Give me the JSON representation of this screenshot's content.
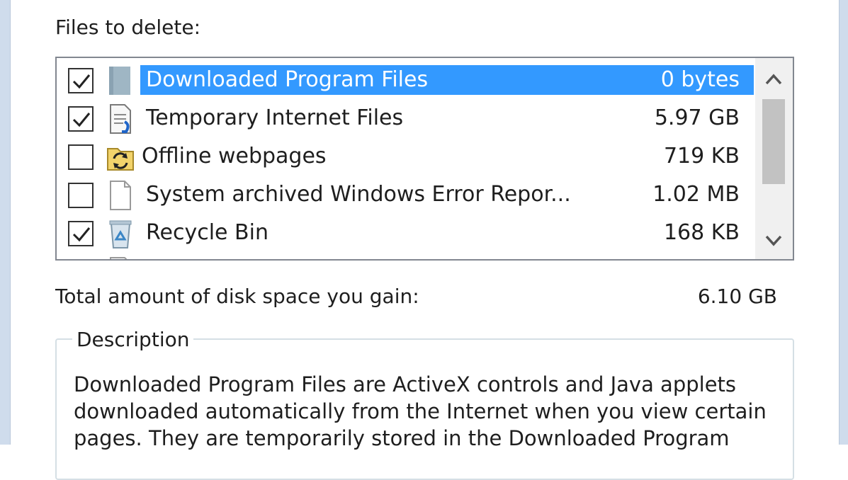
{
  "files_label": "Files to delete:",
  "items": [
    {
      "name": "Downloaded Program Files",
      "size": "0 bytes",
      "checked": true,
      "selected": true,
      "icon": "folder-icon"
    },
    {
      "name": "Temporary Internet Files",
      "size": "5.97 GB",
      "checked": true,
      "selected": false,
      "icon": "internet-file-icon"
    },
    {
      "name": "Offline webpages",
      "size": "719 KB",
      "checked": false,
      "selected": false,
      "icon": "offline-webpages-icon"
    },
    {
      "name": "System archived Windows Error Repor...",
      "size": "1.02 MB",
      "checked": false,
      "selected": false,
      "icon": "blank-document-icon"
    },
    {
      "name": "Recycle Bin",
      "size": "168 KB",
      "checked": true,
      "selected": false,
      "icon": "recycle-bin-icon"
    }
  ],
  "total": {
    "label": "Total amount of disk space you gain:",
    "value": "6.10 GB"
  },
  "description": {
    "title": "Description",
    "text": "Downloaded Program Files are ActiveX controls and Java applets downloaded automatically from the Internet when you view certain pages. They are temporarily stored in the Downloaded Program"
  },
  "colors": {
    "selection": "#3399ff",
    "list_border": "#828790",
    "window_frame": "#cfdcec",
    "scrollbar_track": "#f0f0f0",
    "scrollbar_thumb": "#c2c2c2"
  }
}
